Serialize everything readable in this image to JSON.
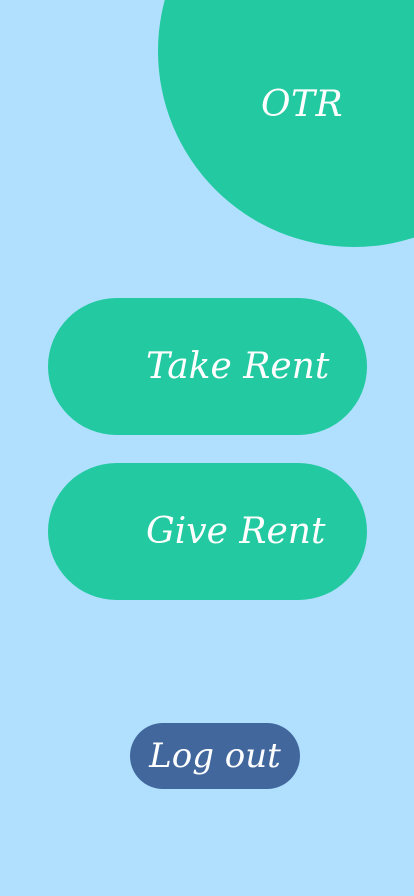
{
  "logo": {
    "text": "OTR"
  },
  "actions": {
    "take_rent_label": "Take Rent",
    "give_rent_label": "Give Rent"
  },
  "account": {
    "logout_label": "Log out"
  },
  "colors": {
    "background": "#b0e0fe",
    "primary": "#23c9a0",
    "logout": "#41679d",
    "text": "#ffffff"
  }
}
